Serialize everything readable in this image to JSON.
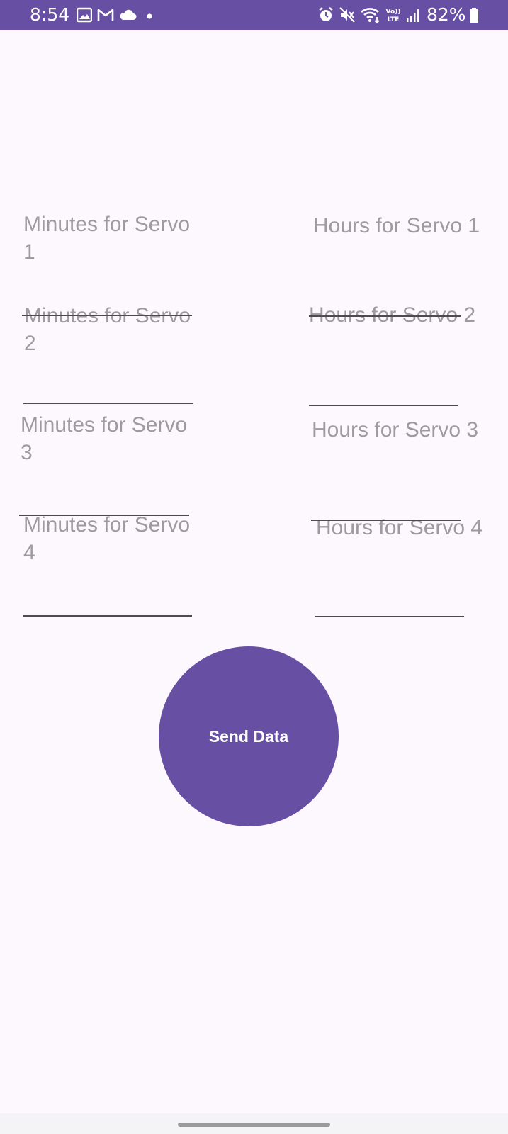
{
  "status_bar": {
    "time": "8:54",
    "battery": "82%",
    "icons": [
      "gallery-icon",
      "gmail-icon",
      "cloud-icon",
      "dot-icon",
      "alarm-icon",
      "mute-icon",
      "wifi-icon",
      "volte-icon",
      "signal-icon",
      "battery-icon"
    ],
    "volte_text_top": "Vo))",
    "volte_text_bottom": "LTE"
  },
  "colors": {
    "accent": "#6750a4",
    "background": "#fdf8fd",
    "label": "#9e9a9f"
  },
  "form": {
    "minutes": [
      {
        "label": "Minutes for Servo 1"
      },
      {
        "label": "Minutes for Servo 2"
      },
      {
        "label": "Minutes for Servo 3"
      },
      {
        "label": "Minutes for Servo 4"
      }
    ],
    "hours": [
      {
        "label": "Hours for Servo 1"
      },
      {
        "label": "Hours for Servo 2"
      },
      {
        "label": "Hours for Servo 3"
      },
      {
        "label": "Hours for Servo 4"
      }
    ]
  },
  "send_button": {
    "label": "Send Data"
  }
}
